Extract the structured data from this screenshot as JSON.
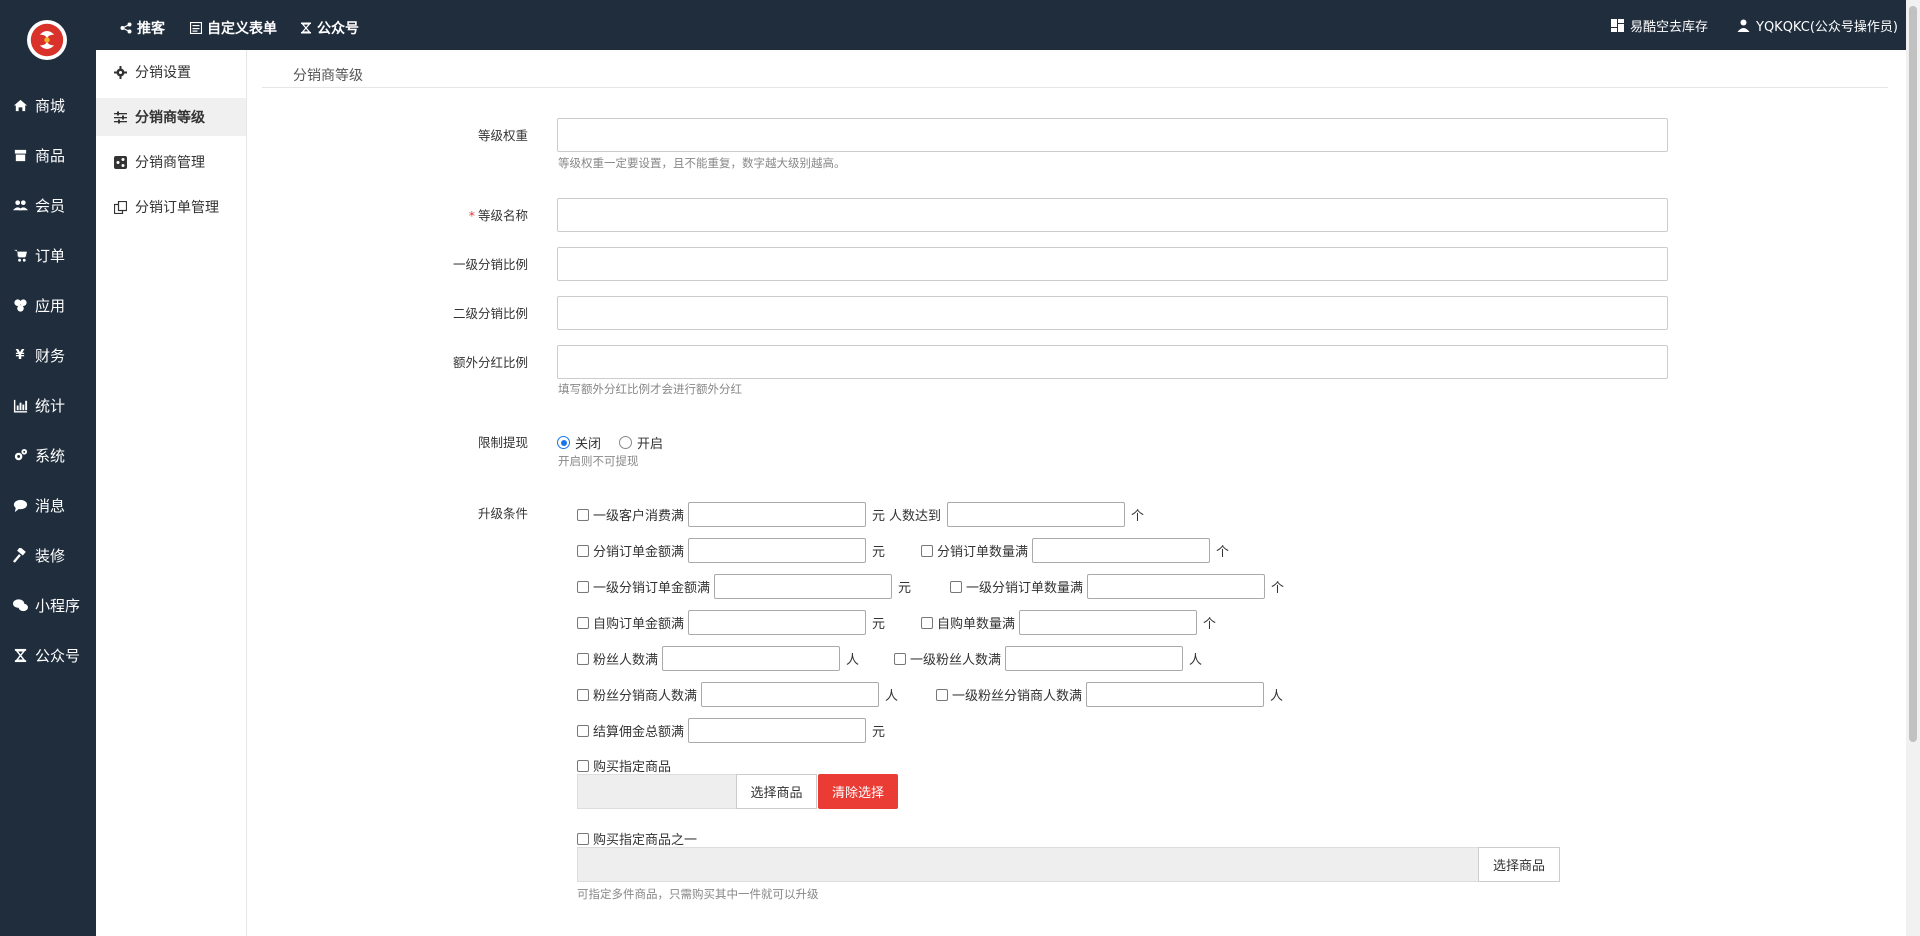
{
  "leftnav": {
    "items": [
      {
        "label": "商城",
        "icon": "home-icon"
      },
      {
        "label": "商品",
        "icon": "box-icon"
      },
      {
        "label": "会员",
        "icon": "users-icon"
      },
      {
        "label": "订单",
        "icon": "cart-icon"
      },
      {
        "label": "应用",
        "icon": "apps-icon"
      },
      {
        "label": "财务",
        "icon": "yen-icon"
      },
      {
        "label": "统计",
        "icon": "chart-icon"
      },
      {
        "label": "系统",
        "icon": "gears-icon"
      },
      {
        "label": "消息",
        "icon": "comment-icon"
      },
      {
        "label": "装修",
        "icon": "hammer-icon"
      },
      {
        "label": "小程序",
        "icon": "wechat-icon"
      },
      {
        "label": "公众号",
        "icon": "hourglass-icon"
      }
    ]
  },
  "topbar": {
    "links": [
      {
        "label": "推客",
        "icon": "share-icon"
      },
      {
        "label": "自定义表单",
        "icon": "form-icon"
      },
      {
        "label": "公众号",
        "icon": "hourglass-icon"
      }
    ],
    "store": "易酷空去库存",
    "user": "YQKQKC(公众号操作员)"
  },
  "subnav": {
    "items": [
      {
        "label": "分销设置",
        "icon": "gear-icon",
        "active": false
      },
      {
        "label": "分销商等级",
        "icon": "sliders-icon",
        "active": true
      },
      {
        "label": "分销商管理",
        "icon": "share-square-icon",
        "active": false
      },
      {
        "label": "分销订单管理",
        "icon": "copy-icon",
        "active": false
      }
    ]
  },
  "page": {
    "title": "分销商等级"
  },
  "form": {
    "weight_label": "等级权重",
    "weight_help": "等级权重一定要设置，且不能重复，数字越大级别越高。",
    "name_label": "等级名称",
    "name_required": "*",
    "level1_label": "一级分销比例",
    "level2_label": "二级分销比例",
    "extra_label": "额外分红比例",
    "extra_help": "填写额外分红比例才会进行额外分红",
    "withdraw_label": "限制提现",
    "withdraw_off": "关闭",
    "withdraw_on": "开启",
    "withdraw_help": "开启则不可提现",
    "upgrade_label": "升级条件",
    "conditions": {
      "c1a": "一级客户消费满",
      "c1u": "元",
      "c1b": "人数达到",
      "c1bu": "个",
      "c2a": "分销订单金额满",
      "c2au": "元",
      "c2b": "分销订单数量满",
      "c2bu": "个",
      "c3a": "一级分销订单金额满",
      "c3au": "元",
      "c3b": "一级分销订单数量满",
      "c3bu": "个",
      "c4a": "自购订单金额满",
      "c4au": "元",
      "c4b": "自购单数量满",
      "c4bu": "个",
      "c5a": "粉丝人数满",
      "c5au": "人",
      "c5b": "一级粉丝人数满",
      "c5bu": "人",
      "c6a": "粉丝分销商人数满",
      "c6au": "人",
      "c6b": "一级粉丝分销商人数满",
      "c6bu": "人",
      "c7a": "结算佣金总额满",
      "c7au": "元",
      "c8": "购买指定商品",
      "c8_pick": "选择商品",
      "c8_clear": "清除选择",
      "c9": "购买指定商品之一",
      "c9_pick": "选择商品",
      "c9_help": "可指定多件商品，只需购买其中一件就可以升级"
    }
  },
  "colors": {
    "nav_bg": "#1f2d3d",
    "accent": "#1a73e8",
    "danger": "#ea3b35"
  }
}
